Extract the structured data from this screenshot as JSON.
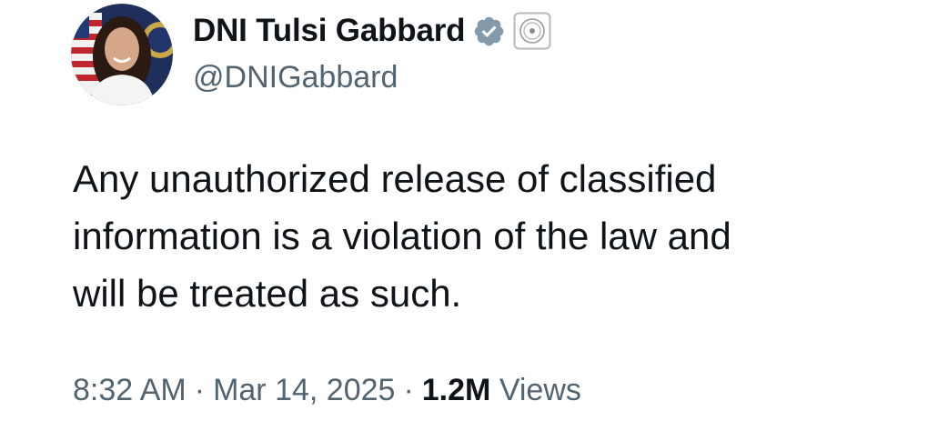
{
  "tweet": {
    "author": {
      "display_name": "DNI Tulsi Gabbard",
      "handle": "@DNIGabbard",
      "verified_badge_icon": "verified-badge-icon",
      "verified_badge_color": "#829aab",
      "affiliation_icon": "government-seal-icon"
    },
    "text_lines": [
      "Any unauthorized release of classified",
      "information is a violation of the law and",
      "will be treated as such."
    ],
    "time": "8:32 AM",
    "separator": "·",
    "date": "Mar 14, 2025",
    "views_count": "1.2M",
    "views_label": "Views"
  },
  "colors": {
    "text_primary": "#0f1419",
    "text_secondary": "#536471"
  }
}
